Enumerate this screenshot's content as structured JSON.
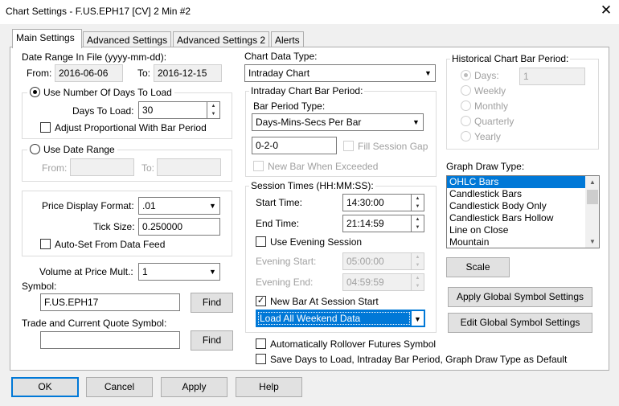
{
  "window": {
    "title": "Chart Settings - F.US.EPH17 [CV]  2 Min  #2"
  },
  "tabs": [
    {
      "label": "Main Settings"
    },
    {
      "label": "Advanced Settings"
    },
    {
      "label": "Advanced Settings 2"
    },
    {
      "label": "Alerts"
    }
  ],
  "date_range": {
    "label": "Date Range In File (yyyy-mm-dd):",
    "from_label": "From:",
    "from_value": "2016-06-06",
    "to_label": "To:",
    "to_value": "2016-12-15"
  },
  "days_group": {
    "radio_label": "Use Number Of Days To Load",
    "days_label": "Days To Load:",
    "days_value": "30",
    "adjust_label": "Adjust Proportional With Bar Period"
  },
  "date_range_group": {
    "radio_label": "Use Date Range",
    "from_label": "From:",
    "to_label": "To:"
  },
  "price_group": {
    "format_label": "Price Display Format:",
    "format_value": ".01",
    "tick_label": "Tick Size:",
    "tick_value": "0.250000",
    "autoset_label": "Auto-Set From Data Feed"
  },
  "volume": {
    "label": "Volume at Price Mult.:",
    "value": "1"
  },
  "symbol": {
    "label": "Symbol:",
    "value": "F.US.EPH17",
    "find_label": "Find"
  },
  "trade_symbol": {
    "label": "Trade and Current Quote Symbol:",
    "value": "",
    "find_label": "Find"
  },
  "chart_data_type": {
    "label": "Chart Data Type:",
    "value": "Intraday Chart"
  },
  "intraday_group": {
    "title": "Intraday Chart Bar Period:",
    "bar_type_label": "Bar Period Type:",
    "bar_type_value": "Days-Mins-Secs Per Bar",
    "period_value": "0-2-0",
    "fill_gap_label": "Fill Session Gap",
    "new_bar_label": "New Bar When Exceeded"
  },
  "session_group": {
    "title": "Session Times (HH:MM:SS):",
    "start_label": "Start Time:",
    "start_value": "14:30:00",
    "end_label": "End Time:",
    "end_value": "21:14:59",
    "evening_label": "Use Evening Session",
    "evening_start_label": "Evening Start:",
    "evening_start_value": "05:00:00",
    "evening_end_label": "Evening End:",
    "evening_end_value": "04:59:59",
    "new_bar_label": "New Bar At Session Start",
    "weekend_value": "Load All Weekend Data"
  },
  "rollover_label": "Automatically Rollover Futures Symbol",
  "save_default_label": "Save Days to Load, Intraday Bar Period, Graph Draw Type as Default",
  "historical_group": {
    "title": "Historical Chart Bar Period:",
    "days_label": "Days:",
    "days_value": "1",
    "weekly": "Weekly",
    "monthly": "Monthly",
    "quarterly": "Quarterly",
    "yearly": "Yearly"
  },
  "graph_draw": {
    "label": "Graph Draw Type:",
    "items": [
      "OHLC Bars",
      "Candlestick Bars",
      "Candlestick Body Only",
      "Candlestick Bars Hollow",
      "Line on Close",
      "Mountain"
    ]
  },
  "buttons": {
    "scale": "Scale",
    "apply_global": "Apply Global Symbol Settings",
    "edit_global": "Edit Global Symbol Settings",
    "ok": "OK",
    "cancel": "Cancel",
    "apply": "Apply",
    "help": "Help"
  },
  "icons": {
    "close": "close-icon",
    "dropdown": "chevron-down-icon",
    "check": "check-icon"
  },
  "colors": {
    "selection": "#0078d7",
    "background": "#f0f0f0"
  }
}
